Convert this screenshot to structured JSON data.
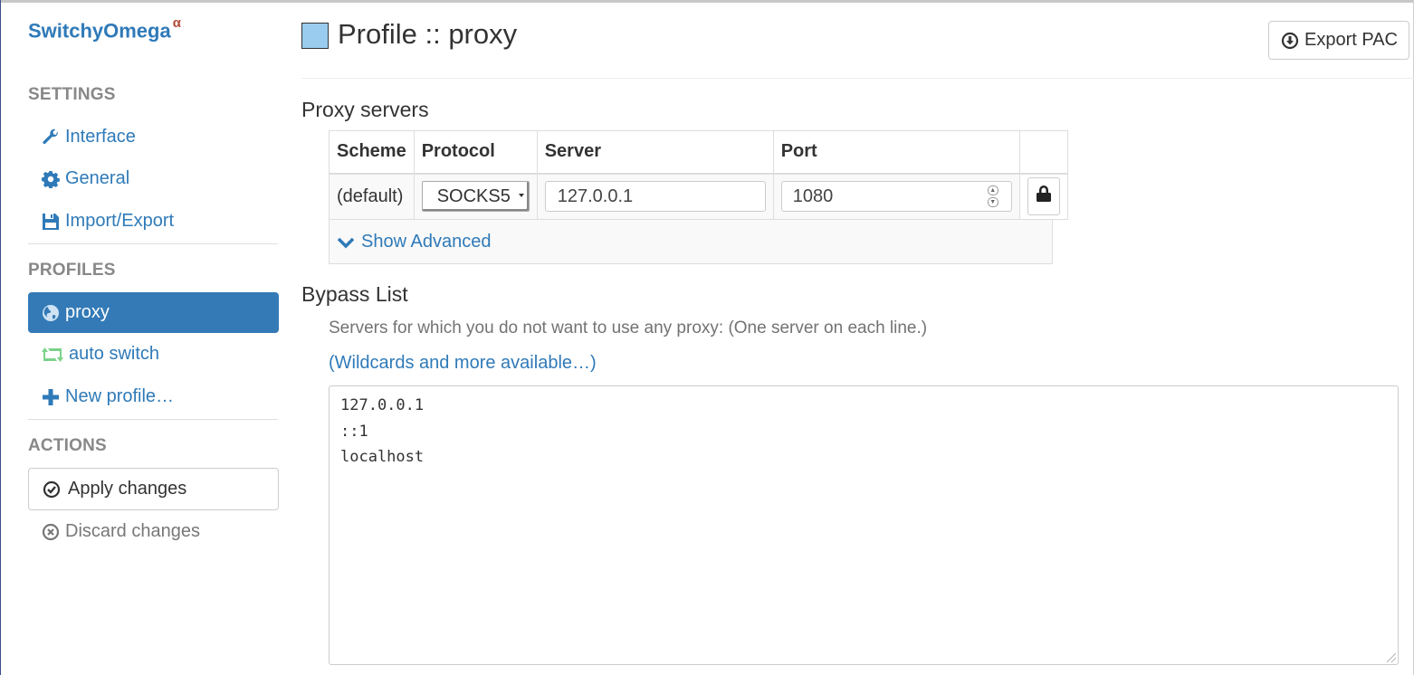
{
  "app": {
    "name": "SwitchyOmega",
    "version_mark": "α"
  },
  "sidebar": {
    "settings_header": "SETTINGS",
    "settings_items": [
      {
        "label": "Interface",
        "icon": "wrench-icon"
      },
      {
        "label": "General",
        "icon": "gear-icon"
      },
      {
        "label": "Import/Export",
        "icon": "floppy-icon"
      }
    ],
    "profiles_header": "PROFILES",
    "profiles": [
      {
        "label": "proxy",
        "icon": "globe-icon",
        "active": true
      },
      {
        "label": "auto switch",
        "icon": "retweet-icon",
        "icon_color": "#7bd28a"
      },
      {
        "label": "New profile…",
        "icon": "plus-icon"
      }
    ],
    "actions_header": "ACTIONS",
    "apply_label": "Apply changes",
    "discard_label": "Discard changes"
  },
  "header": {
    "title": "Profile :: proxy",
    "swatch_color": "#99ccee",
    "export_label": "Export PAC"
  },
  "proxy_servers": {
    "title": "Proxy servers",
    "columns": [
      "Scheme",
      "Protocol",
      "Server",
      "Port"
    ],
    "row": {
      "scheme": "(default)",
      "protocol": "SOCKS5",
      "server": "127.0.0.1",
      "port": "1080"
    },
    "show_advanced_label": "Show Advanced"
  },
  "bypass": {
    "title": "Bypass List",
    "help": "Servers for which you do not want to use any proxy: (One server on each line.)",
    "wildcards_link": "(Wildcards and more available…)",
    "lines": [
      "127.0.0.1",
      "::1",
      "localhost"
    ]
  },
  "colors": {
    "link": "#2f7ab8",
    "active_bg": "#337ab7",
    "muted": "#888888"
  }
}
